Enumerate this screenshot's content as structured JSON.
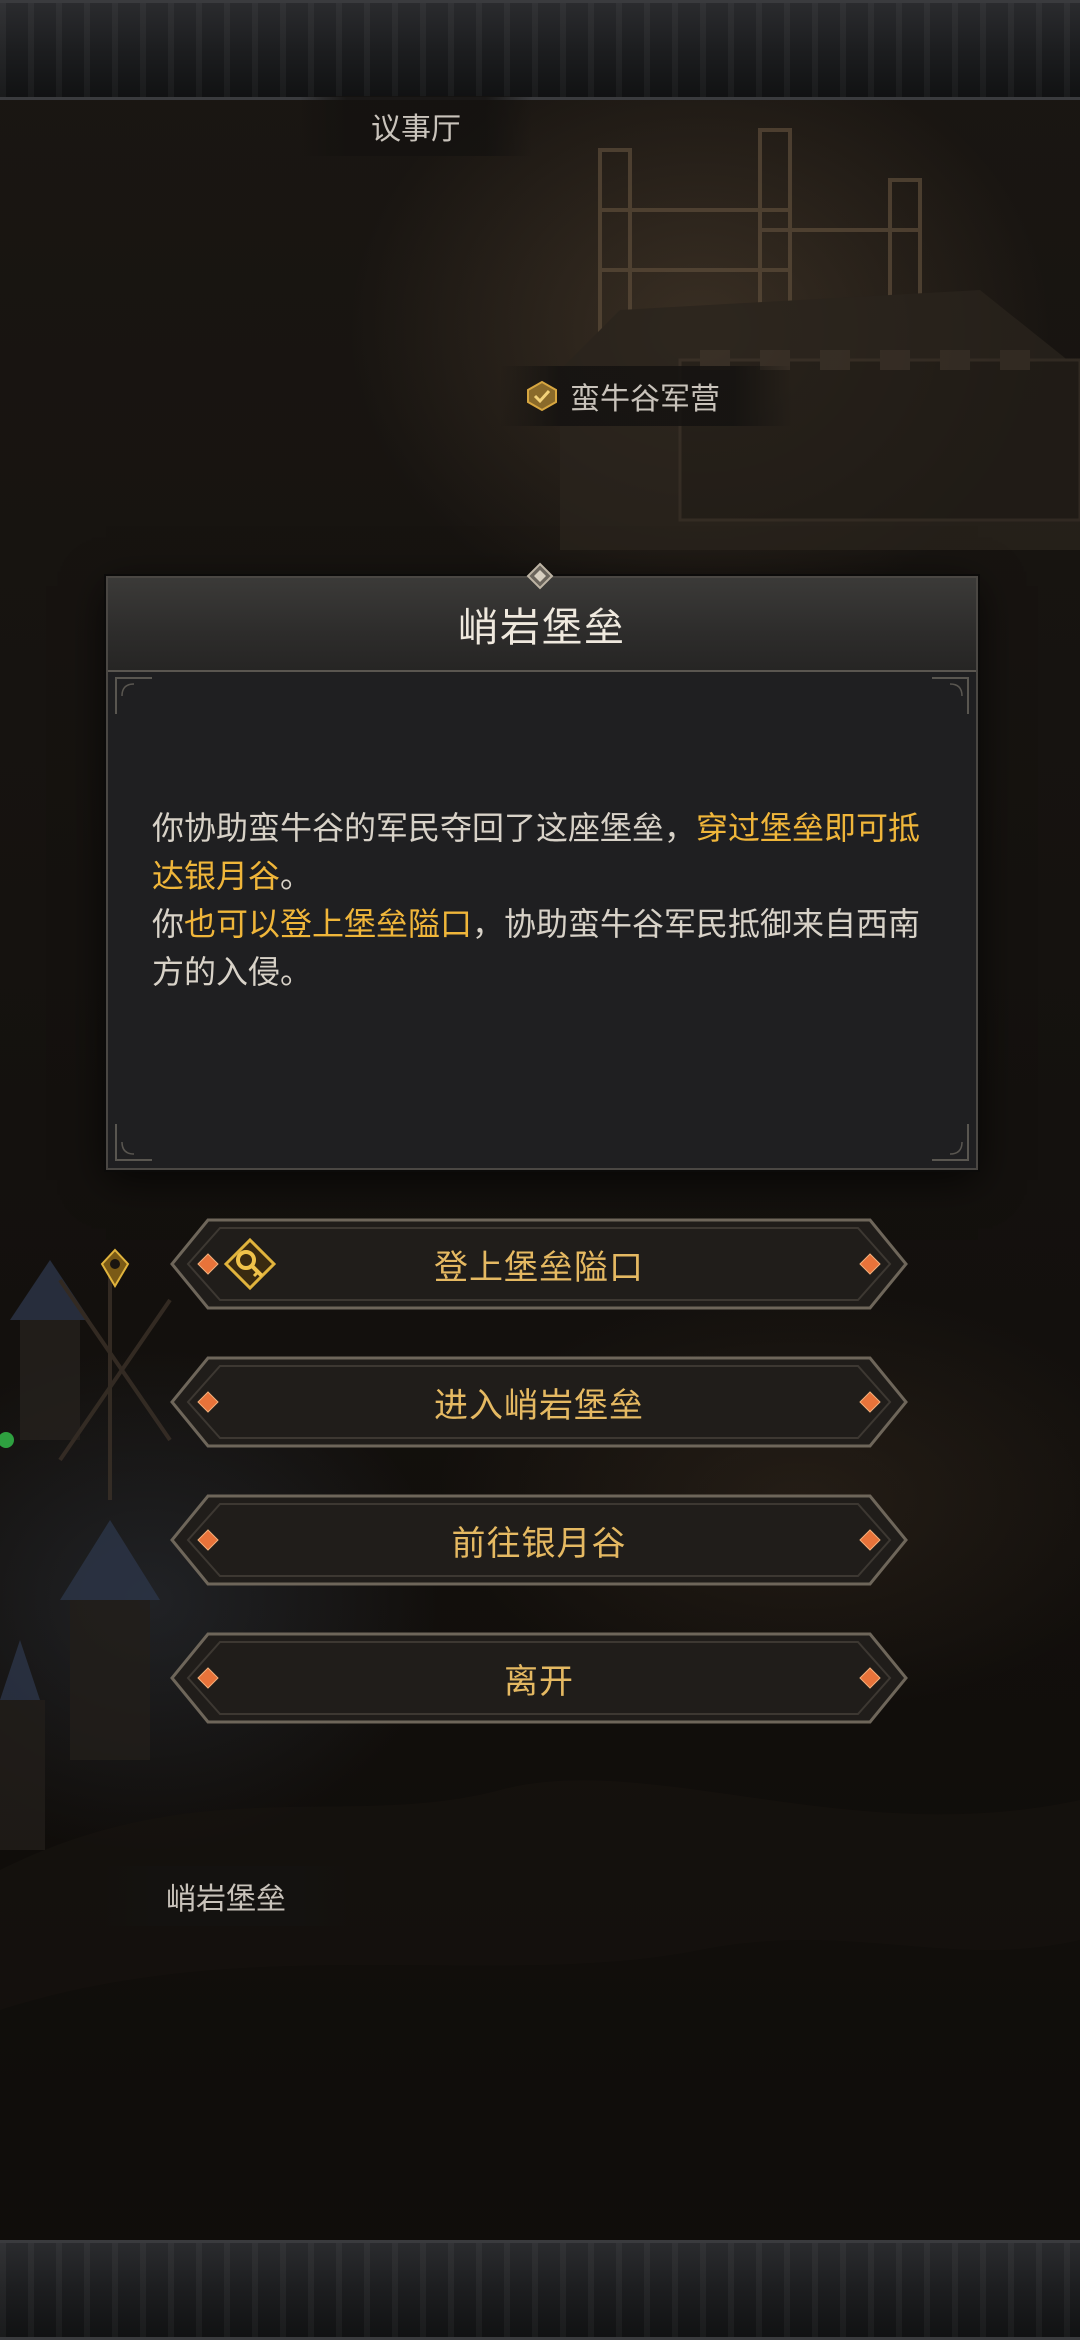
{
  "map": {
    "label_council_hall": "议事厅",
    "label_camp": "蛮牛谷军营",
    "label_fortress": "峭岩堡垒"
  },
  "dialog": {
    "title": "峭岩堡垒",
    "body": {
      "p1_normal": "你协助蛮牛谷的军民夺回了这座堡垒，",
      "p1_highlight": "穿过堡垒即可抵达银月谷",
      "p1_end": "。",
      "p2_start": "你",
      "p2_highlight": "也可以登上堡垒隘口",
      "p2_end": "，协助蛮牛谷军民抵御来自西南方的入侵。"
    }
  },
  "actions": {
    "climb": "登上堡垒隘口",
    "enter": "进入峭岩堡垒",
    "goto": "前往银月谷",
    "leave": "离开"
  },
  "colors": {
    "highlight": "#f0b63a",
    "button_text": "#e5b962",
    "dialog_bg": "#1f1f21",
    "gem_orange": "#e8733a"
  },
  "icons": {
    "camp_check": "check-icon",
    "climb_action": "key-icon",
    "side_marker": "map-marker-icon"
  }
}
